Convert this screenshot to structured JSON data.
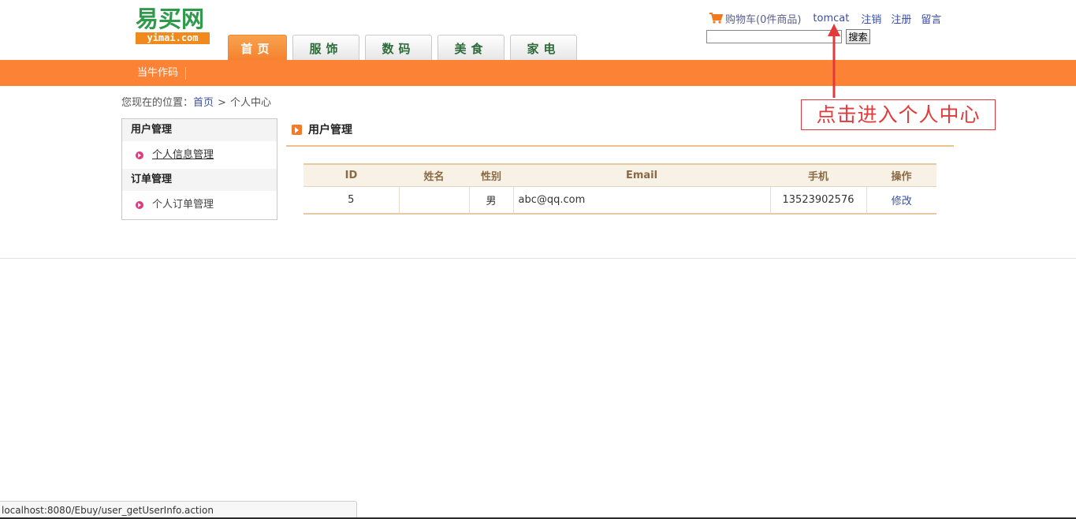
{
  "logo": {
    "text": "易买网",
    "sub": "yimai.com"
  },
  "top_links": {
    "cart": "购物车(0件商品)",
    "user": "tomcat",
    "logout": "注销",
    "register": "注册",
    "message": "留言",
    "cart_icon": "cart-icon"
  },
  "search": {
    "value": "",
    "button": "搜索"
  },
  "nav": {
    "tabs": [
      {
        "label": "首页",
        "active": true
      },
      {
        "label": "服饰",
        "active": false
      },
      {
        "label": "数码",
        "active": false
      },
      {
        "label": "美食",
        "active": false
      },
      {
        "label": "家电",
        "active": false
      }
    ]
  },
  "subnav": {
    "link": "当牛作码"
  },
  "breadcrumb": {
    "prefix": "您现在的位置：",
    "home": "首页",
    "separator": ">",
    "current": "个人中心"
  },
  "sidebar": {
    "sections": [
      {
        "title": "用户管理",
        "item": "个人信息管理"
      },
      {
        "title": "订单管理",
        "item": "个人订单管理"
      }
    ]
  },
  "content": {
    "title": "用户管理",
    "table": {
      "headers": [
        "ID",
        "姓名",
        "性别",
        "Email",
        "手机",
        "操作"
      ],
      "rows": [
        {
          "id": "5",
          "name": "",
          "gender": "男",
          "email": "abc@qq.com",
          "phone": "13523902576",
          "action": "修改"
        }
      ]
    }
  },
  "annotation": {
    "text": "点击进入个人中心",
    "color": "#e23a3a"
  },
  "status_bar": {
    "url": "localhost:8080/Ebuy/user_getUserInfo.action"
  },
  "colors": {
    "accent": "#fc8236",
    "link": "#3a4ea0",
    "logo_green": "#2e9a4a"
  }
}
